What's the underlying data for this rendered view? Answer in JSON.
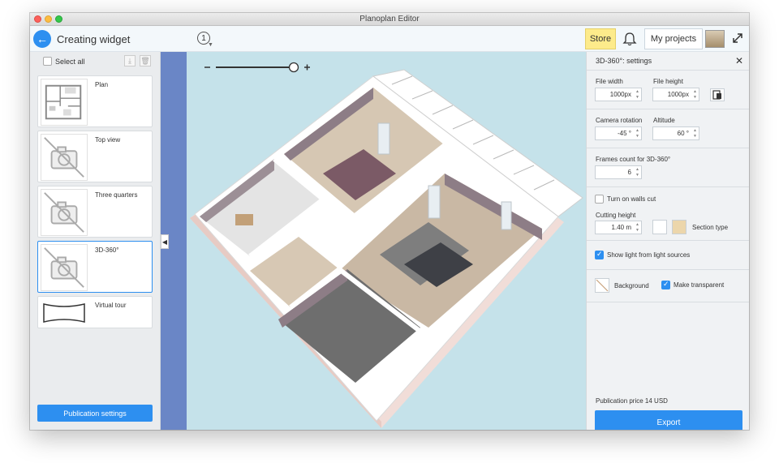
{
  "window": {
    "title": "Planoplan Editor"
  },
  "header": {
    "title": "Creating widget",
    "step": "1",
    "store_label": "Store",
    "my_projects_label": "My projects"
  },
  "left": {
    "select_all_label": "Select all",
    "cards": [
      {
        "label": "Plan",
        "thumb": "plan-thumbnail"
      },
      {
        "label": "Top view",
        "thumb": "no-camera-icon"
      },
      {
        "label": "Three quarters",
        "thumb": "no-camera-icon"
      },
      {
        "label": "3D-360°",
        "thumb": "no-camera-icon",
        "selected": true
      },
      {
        "label": "Virtual tour",
        "thumb": "panorama-icon"
      }
    ],
    "publication_button": "Publication settings"
  },
  "viewport": {
    "zoom_minus": "−",
    "zoom_plus": "+",
    "zoom_level": 0.85
  },
  "right": {
    "title": "3D-360°: settings",
    "file_width_label": "File width",
    "file_width_value": "1000px",
    "file_height_label": "File height",
    "file_height_value": "1000px",
    "camera_rotation_label": "Camera rotation",
    "camera_rotation_value": "-45 °",
    "altitude_label": "Altitude",
    "altitude_value": "60 °",
    "frames_label": "Frames count for 3D-360°",
    "frames_value": "6",
    "walls_cut_label": "Turn on walls cut",
    "walls_cut_checked": false,
    "cutting_height_label": "Cutting height",
    "cutting_height_value": "1.40 m",
    "section_type_label": "Section type",
    "light_label": "Show light from light sources",
    "light_checked": true,
    "background_label": "Background",
    "transparent_label": "Make transparent",
    "transparent_checked": true,
    "price_label": "Publication price 14 USD",
    "export_label": "Export"
  },
  "colors": {
    "accent": "#2d8ff0",
    "store": "#fdeb8b",
    "viewport_bg": "#c5e2ea",
    "strip": "#6a86c6"
  }
}
